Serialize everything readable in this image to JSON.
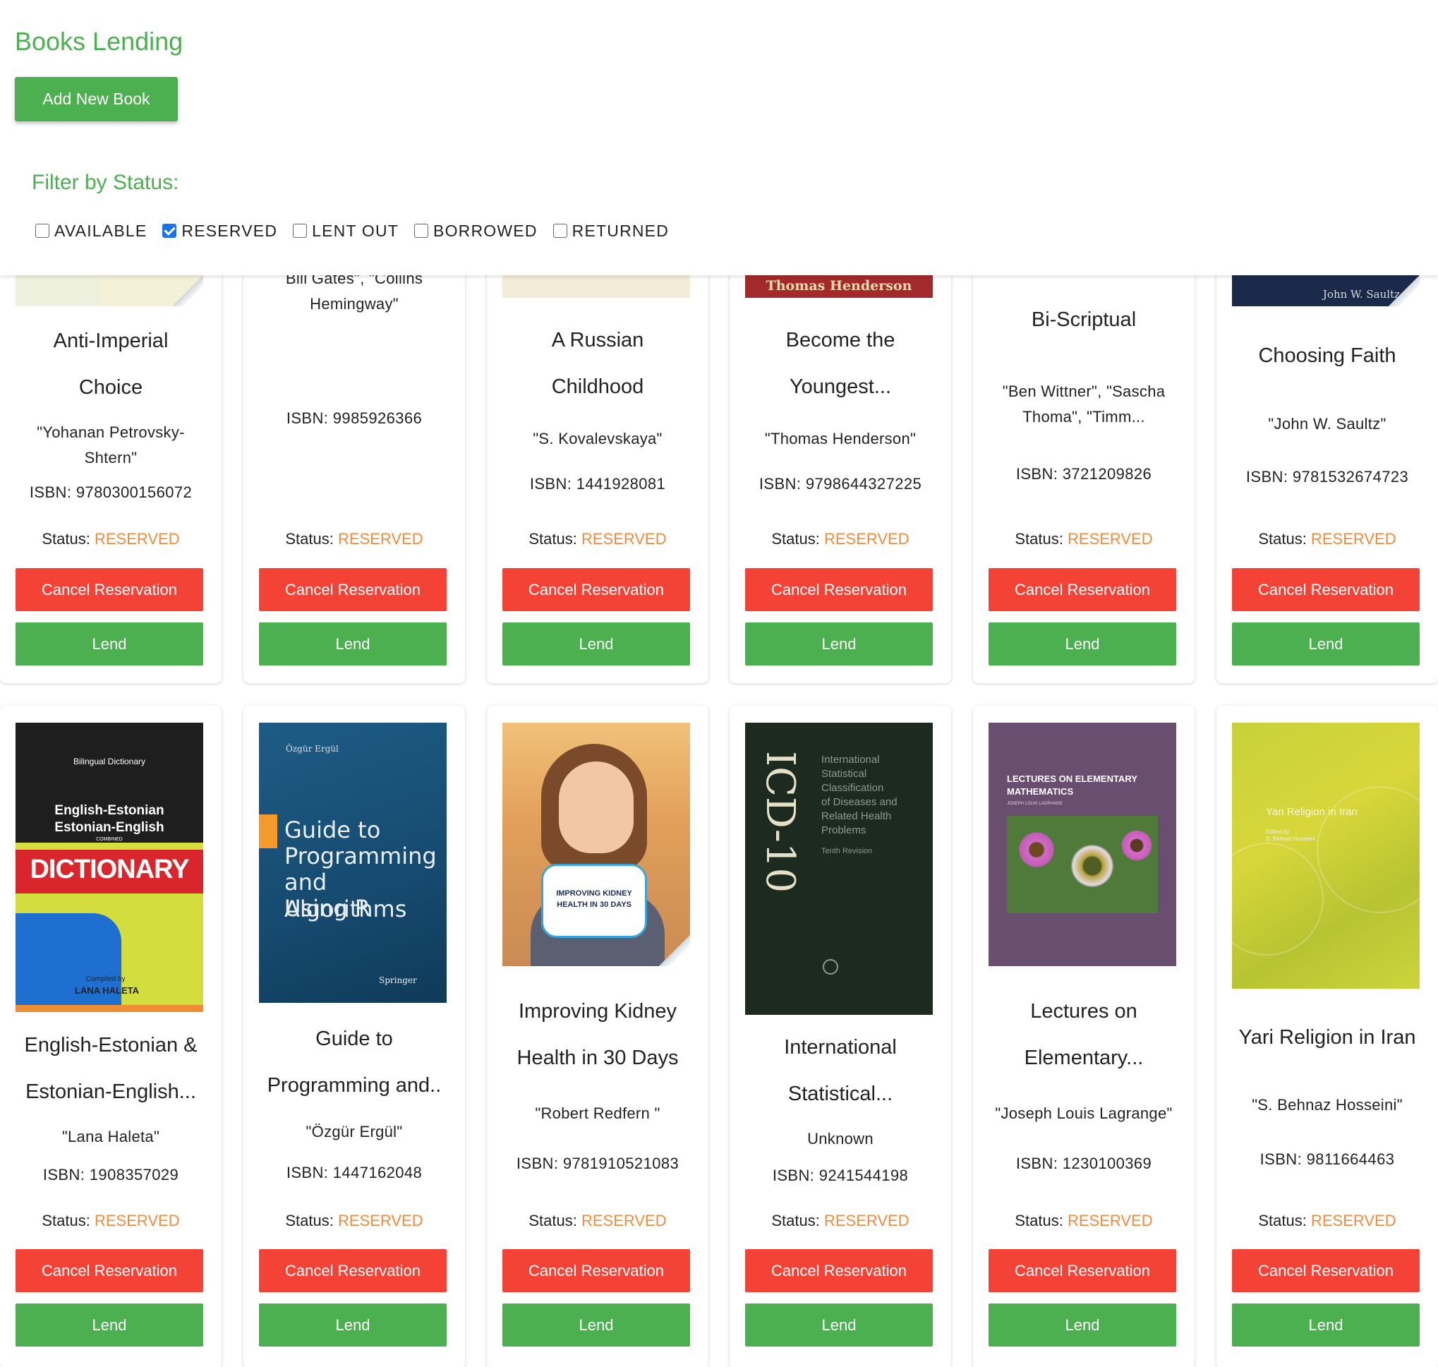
{
  "app": {
    "title": "Books Lending",
    "add_button": "Add New Book"
  },
  "filter": {
    "title": "Filter by Status:",
    "options": [
      {
        "label": "AVAILABLE",
        "checked": false
      },
      {
        "label": "RESERVED",
        "checked": true
      },
      {
        "label": "LENT OUT",
        "checked": false
      },
      {
        "label": "BORROWED",
        "checked": false
      },
      {
        "label": "RETURNED",
        "checked": false
      }
    ]
  },
  "labels": {
    "status_prefix": "Status:",
    "cancel": "Cancel Reservation",
    "lend": "Lend"
  },
  "row1": [
    {
      "title_lines": [
        "Anti-Imperial",
        "Choice"
      ],
      "author_lines": [
        "\"Yohanan Petrovsky-",
        "Shtern\""
      ],
      "isbn": "ISBN: 9780300156072",
      "status": "RESERVED"
    },
    {
      "title_lines": [],
      "author_lines": [
        "Bill Gates\", \"Collins",
        "Hemingway\""
      ],
      "isbn": "ISBN: 9985926366",
      "status": "RESERVED"
    },
    {
      "title_lines": [
        "A Russian",
        "Childhood"
      ],
      "author_lines": [
        "\"S. Kovalevskaya\""
      ],
      "isbn": "ISBN: 1441928081",
      "status": "RESERVED"
    },
    {
      "title_lines": [
        "Become the",
        "Youngest..."
      ],
      "author_lines": [
        "\"Thomas Henderson\""
      ],
      "isbn": "ISBN: 9798644327225",
      "status": "RESERVED",
      "cover_text": "Thomas Henderson"
    },
    {
      "title_lines": [
        "Bi-Scriptual"
      ],
      "author_lines": [
        "\"Ben Wittner\", \"Sascha",
        "Thoma\", \"Timm..."
      ],
      "isbn": "ISBN: 3721209826",
      "status": "RESERVED"
    },
    {
      "title_lines": [
        "Choosing Faith"
      ],
      "author_lines": [
        "\"John W. Saultz\""
      ],
      "isbn": "ISBN: 9781532674723",
      "status": "RESERVED",
      "cover_text": "John W. Saultz"
    }
  ],
  "row2": [
    {
      "title_lines": [
        "English-Estonian &",
        "Estonian-English..."
      ],
      "author_lines": [
        "\"Lana Haleta\""
      ],
      "isbn": "ISBN: 1908357029",
      "status": "RESERVED",
      "cover": {
        "top": "Bilingual Dictionary",
        "line1": "English-Estonian",
        "line2": "Estonian-English",
        "combined": "COMBINED",
        "big": "DICTIONARY",
        "compiled": "Compiled by",
        "name": "LANA HALETA"
      }
    },
    {
      "title_lines": [
        "Guide to",
        "Programming and.."
      ],
      "author_lines": [
        "\"Özgür Ergül\""
      ],
      "isbn": "ISBN: 1447162048",
      "status": "RESERVED",
      "cover": {
        "author": "Özgür Ergül",
        "l1": "Guide to",
        "l2": "Programming",
        "l3": "and Algorithms",
        "l4": "Using R",
        "publisher": "Springer"
      }
    },
    {
      "title_lines": [
        "Improving Kidney",
        "Health in 30 Days"
      ],
      "author_lines": [
        "\"Robert Redfern \""
      ],
      "isbn": "ISBN: 9781910521083",
      "status": "RESERVED",
      "cover": {
        "badge1": "IMPROVING KIDNEY",
        "badge2": "HEALTH IN 30 DAYS"
      }
    },
    {
      "title_lines": [
        "International",
        "Statistical..."
      ],
      "author_lines": [
        "Unknown"
      ],
      "isbn": "ISBN: 9241544198",
      "status": "RESERVED",
      "cover": {
        "spine": "ICD-10",
        "l1": "International",
        "l2": "Statistical",
        "l3": "Classification",
        "l4": "of Diseases and",
        "l5": "Related Health",
        "l6": "Problems",
        "l7": "Tenth Revision"
      }
    },
    {
      "title_lines": [
        "Lectures on",
        "Elementary..."
      ],
      "author_lines": [
        "\"Joseph Louis Lagrange\""
      ],
      "isbn": "ISBN: 1230100369",
      "status": "RESERVED",
      "cover": {
        "l1": "LECTURES ON ELEMENTARY",
        "l2": "MATHEMATICS",
        "author": "JOSEPH LOUIS LAGRANGE"
      }
    },
    {
      "title_lines": [
        "Yari Religion in Iran"
      ],
      "author_lines": [
        "\"S. Behnaz Hosseini\""
      ],
      "isbn": "ISBN: 9811664463",
      "status": "RESERVED",
      "cover": {
        "title": "Yari Religion in Iran",
        "edited": "Edited by",
        "editor": "S. Behnaz Hosseini"
      }
    }
  ],
  "colors": {
    "accent": "#4caf50",
    "danger": "#f44336",
    "reserved": "#f28a3c",
    "checkbox": "#1a73e8"
  }
}
